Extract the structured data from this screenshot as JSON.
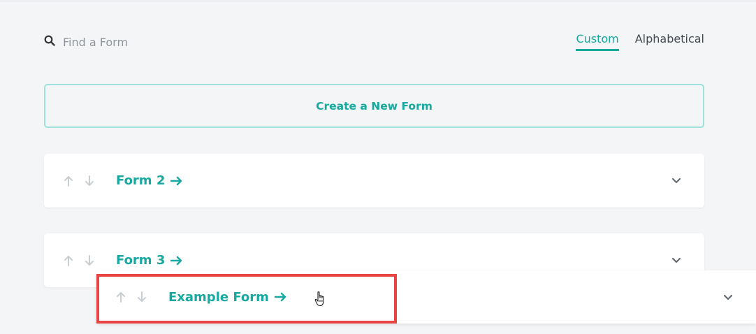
{
  "search": {
    "placeholder": "Find a Form",
    "icon": "search-icon"
  },
  "sort_tabs": [
    {
      "label": "Custom",
      "active": true
    },
    {
      "label": "Alphabetical",
      "active": false
    }
  ],
  "create_button": {
    "label": "Create a New Form"
  },
  "forms": [
    {
      "name": "Form 2"
    },
    {
      "name": "Form 3"
    }
  ],
  "dragged_form": {
    "name": "Example Form"
  },
  "colors": {
    "accent": "#17a99f",
    "highlight": "#e84444",
    "background": "#f4f5f7",
    "muted_arrow": "#c9ced3"
  }
}
